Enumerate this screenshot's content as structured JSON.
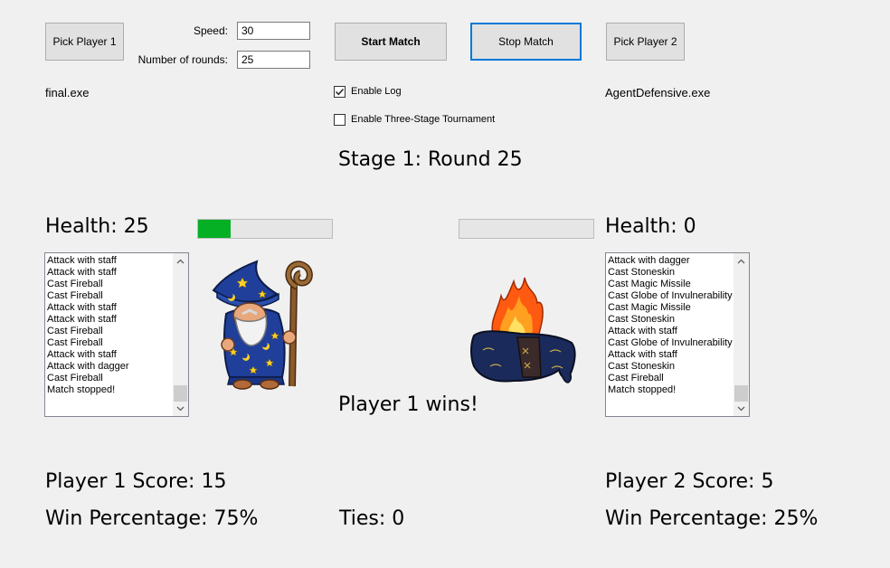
{
  "controls": {
    "pick_player1": "Pick Player 1",
    "pick_player2": "Pick Player 2",
    "speed_label": "Speed:",
    "speed_value": "30",
    "rounds_label": "Number of rounds:",
    "rounds_value": "25",
    "start_match": "Start Match",
    "stop_match": "Stop Match",
    "enable_log": "Enable Log",
    "enable_log_checked": true,
    "enable_tournament": "Enable Three-Stage Tournament",
    "enable_tournament_checked": false
  },
  "player1": {
    "file": "final.exe",
    "health_label": "Health: 25",
    "health_fraction": 0.24,
    "log": [
      "Attack with staff",
      "Attack with staff",
      "Cast Fireball",
      "Cast Fireball",
      "Attack with staff",
      "Attack with staff",
      "Cast Fireball",
      "Cast Fireball",
      "Attack with staff",
      "Attack with dagger",
      "Cast Fireball",
      "Match stopped!"
    ],
    "score": "Player 1 Score: 15",
    "win_pct": "Win Percentage: 75%"
  },
  "player2": {
    "file": "AgentDefensive.exe",
    "health_label": "Health: 0",
    "health_fraction": 0,
    "log": [
      "Attack with dagger",
      "Cast Stoneskin",
      "Cast Magic Missile",
      "Cast Globe of Invulnerability",
      "Cast Magic Missile",
      "Cast Stoneskin",
      "Attack with staff",
      "Cast Globe of Invulnerability",
      "Attack with staff",
      "Cast Stoneskin",
      "Cast Fireball",
      "Match stopped!"
    ],
    "score": "Player 2 Score: 5",
    "win_pct": "Win Percentage: 25%"
  },
  "status": {
    "stage": "Stage 1: Round 25",
    "result": "Player 1 wins!",
    "ties": "Ties: 0"
  },
  "colors": {
    "progress_fill": "#06b025",
    "accent": "#0078d7",
    "robe": "#1f3f9a",
    "star": "#ffd02a"
  },
  "icons": {
    "check": "checkmark-icon",
    "up": "scroll-up-arrow-icon",
    "down": "scroll-down-arrow-icon"
  }
}
